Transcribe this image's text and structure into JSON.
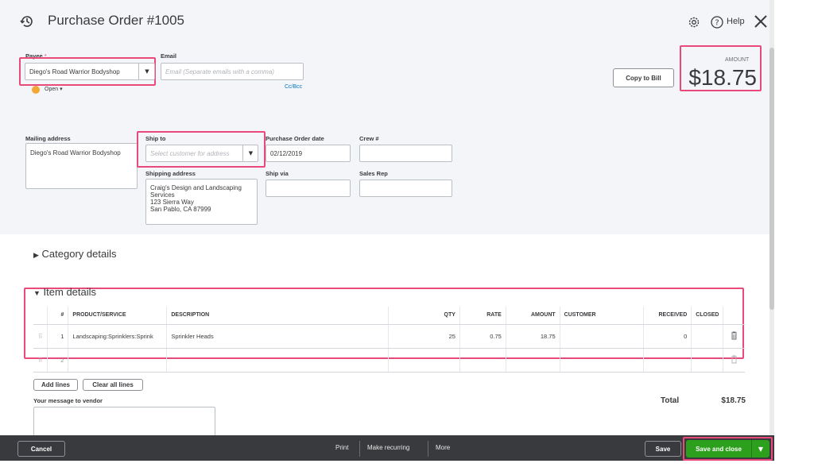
{
  "header": {
    "title": "Purchase Order #1005",
    "help_label": "Help"
  },
  "payee": {
    "label": "Payee",
    "value": "Diego's Road Warrior Bodyshop",
    "status": "Open"
  },
  "email": {
    "label": "Email",
    "placeholder": "Email (Separate emails with a comma)",
    "cc_bcc": "Cc/Bcc"
  },
  "copy_to_bill": "Copy to Bill",
  "amount": {
    "label": "AMOUNT",
    "value": "$18.75"
  },
  "mailing_address": {
    "label": "Mailing address",
    "value": "Diego's Road Warrior Bodyshop"
  },
  "ship_to": {
    "label": "Ship to",
    "placeholder": "Select customer for address"
  },
  "shipping_address": {
    "label": "Shipping address",
    "lines": [
      "Craig's Design and Landscaping",
      "Services",
      "123 Sierra Way",
      "San Pablo, CA  87999"
    ]
  },
  "po_date": {
    "label": "Purchase Order date",
    "value": "02/12/2019"
  },
  "crew": {
    "label": "Crew #",
    "value": ""
  },
  "ship_via": {
    "label": "Ship via",
    "value": ""
  },
  "sales_rep": {
    "label": "Sales Rep",
    "value": ""
  },
  "category_details": "Category details",
  "item_details": "Item details",
  "table": {
    "columns": [
      "#",
      "PRODUCT/SERVICE",
      "DESCRIPTION",
      "QTY",
      "RATE",
      "AMOUNT",
      "CUSTOMER",
      "RECEIVED",
      "CLOSED"
    ],
    "rows": [
      {
        "num": "1",
        "product": "Landscaping:Sprinklers:Sprink",
        "description": "Sprinkler Heads",
        "qty": "25",
        "rate": "0.75",
        "amount": "18.75",
        "customer": "",
        "received": "0"
      },
      {
        "num": "2",
        "product": "",
        "description": "",
        "qty": "",
        "rate": "",
        "amount": "",
        "customer": "",
        "received": ""
      }
    ]
  },
  "add_lines": "Add lines",
  "clear_all_lines": "Clear all lines",
  "message_label": "Your message to vendor",
  "total": {
    "label": "Total",
    "value": "$18.75"
  },
  "footer": {
    "cancel": "Cancel",
    "print": "Print",
    "make_recurring": "Make recurring",
    "more": "More",
    "save": "Save",
    "save_and_close": "Save and close"
  },
  "colors": {
    "highlight": "#e94a7a",
    "save_green": "#2ca01c",
    "footer_bg": "#393a3d"
  }
}
